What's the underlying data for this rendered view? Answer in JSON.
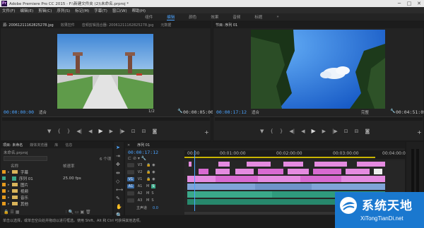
{
  "titlebar": {
    "app_icon": "Pr",
    "title": "Adobe Premiere Pro CC 2015 - F:\\新建文件夹 (2)\\未命名.prproj *",
    "minimize": "─",
    "maximize": "□",
    "close": "✕"
  },
  "menu": [
    "文件(F)",
    "编辑(E)",
    "剪辑(C)",
    "序列(S)",
    "标记(M)",
    "字幕(T)",
    "窗口(W)",
    "帮助(H)"
  ],
  "workspace": {
    "tabs": [
      "组件",
      "编辑",
      "颜色",
      "效果",
      "音频",
      "标题"
    ],
    "active": "编辑",
    "more": "»"
  },
  "source_panel": {
    "tabs": [
      "源: 20061211162825278.jpg",
      "效果控件",
      "音频剪辑混合器: 20061211162825278.jpg",
      "元数据"
    ],
    "timecode": "00:00:00:00",
    "fit": "适合",
    "fraction": "1/2",
    "duration": "00:00:05:00"
  },
  "program_panel": {
    "tabs": [
      "节目: 序列 01"
    ],
    "timecode": "00:00:17:12",
    "fit": "适合",
    "quality": "完整",
    "duration": "00:04:51:05"
  },
  "project_panel": {
    "tabs": [
      "项目: 未命名",
      "媒体浏览器",
      "库",
      "信息"
    ],
    "file": "未命名.prproj",
    "count": "6 个项",
    "col_name": "名称",
    "col_rate": "帧速率",
    "items": [
      {
        "name": "字幕",
        "rate": ""
      },
      {
        "name": "序列 01",
        "rate": "25.00 fps"
      },
      {
        "name": "图片",
        "rate": ""
      },
      {
        "name": "视频",
        "rate": ""
      },
      {
        "name": "音乐",
        "rate": ""
      },
      {
        "name": "其他",
        "rate": ""
      }
    ]
  },
  "timeline": {
    "tab": "序列 01",
    "timecode": "00:00:17:12",
    "ruler_labels": [
      "00:00",
      "00:01:00:00",
      "00:02:00:00",
      "00:03:00:00",
      "00:04:00:00"
    ],
    "tracks": [
      "V3",
      "V2",
      "V1",
      "A1",
      "A2",
      "A3"
    ],
    "master_label": "主声道",
    "master_value": "0.0"
  },
  "status_text": "单击以选择，或单击空白处并拖动以进行框选。使用 Shift、Alt 和 Ctrl 可获得其他选项。",
  "watermark": {
    "title": "系统天地",
    "url": "XiTongTianDi.net"
  },
  "colors": {
    "accent": "#4aa3ff",
    "clip_pink": "#e58be0",
    "clip_blue": "#7fa4d8",
    "clip_green": "#3aa98a"
  }
}
